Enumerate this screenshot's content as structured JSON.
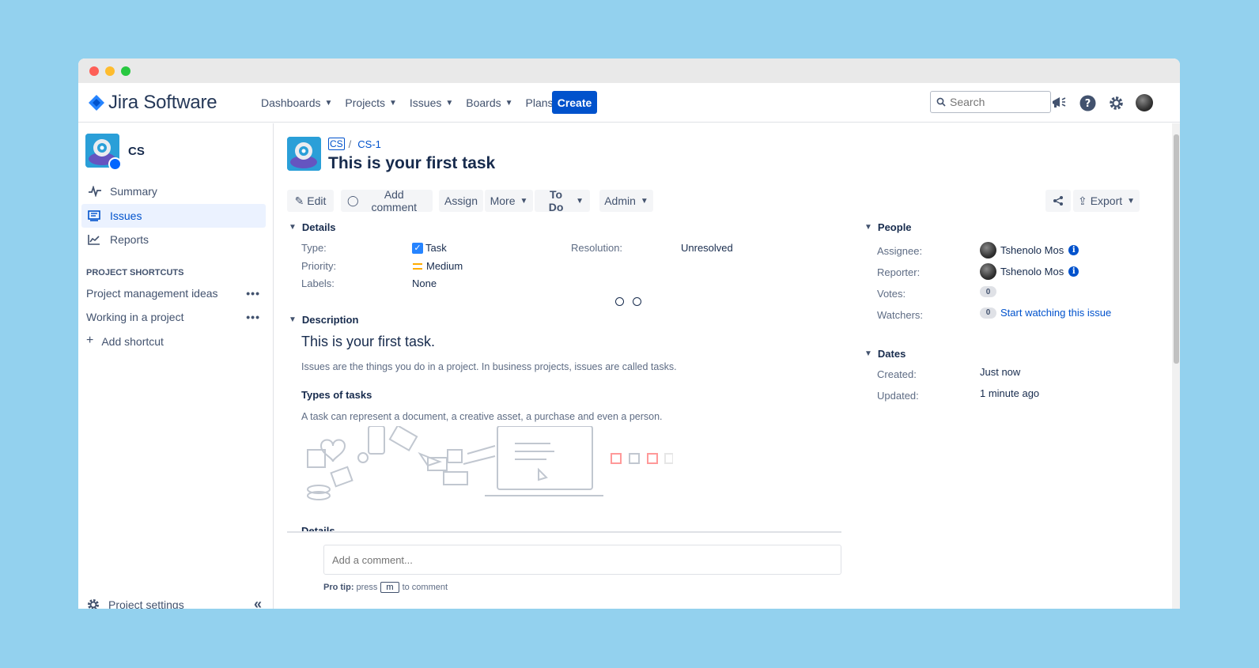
{
  "app": {
    "name": "Jira Software"
  },
  "nav": {
    "items": [
      "Dashboards",
      "Projects",
      "Issues",
      "Boards",
      "Plans"
    ],
    "create_label": "Create",
    "search_placeholder": "Search"
  },
  "sidebar": {
    "project_name": "CS",
    "items": [
      {
        "label": "Summary",
        "icon": "pulse-icon"
      },
      {
        "label": "Issues",
        "icon": "issues-icon",
        "active": true
      },
      {
        "label": "Reports",
        "icon": "chart-icon"
      }
    ],
    "shortcuts_heading": "PROJECT SHORTCUTS",
    "shortcuts": [
      "Project management ideas",
      "Working in a project"
    ],
    "add_shortcut": "Add shortcut",
    "settings": "Project settings"
  },
  "issue": {
    "project_key": "CS",
    "key": "CS-1",
    "title": "This is your first task",
    "buttons": {
      "edit": "Edit",
      "add_comment": "Add comment",
      "assign": "Assign",
      "more": "More",
      "status": "To Do",
      "admin": "Admin",
      "export": "Export"
    },
    "details": {
      "heading": "Details",
      "type_label": "Type:",
      "type_value": "Task",
      "priority_label": "Priority:",
      "priority_value": "Medium",
      "labels_label": "Labels:",
      "labels_value": "None",
      "resolution_label": "Resolution:",
      "resolution_value": "Unresolved"
    },
    "description": {
      "heading": "Description",
      "title": "This is your first task.",
      "text1": "Issues are the things you do in a project. In business projects, issues are called tasks.",
      "subheading": "Types of tasks",
      "text2": "A task can represent a document, a creative asset, a purchase and even a person.",
      "cut_heading": "Details"
    },
    "comment": {
      "placeholder": "Add a comment...",
      "protip_bold": "Pro tip:",
      "protip_pre": "press",
      "protip_key": "m",
      "protip_post": "to comment"
    },
    "people": {
      "heading": "People",
      "assignee_label": "Assignee:",
      "assignee": "Tshenolo Mos",
      "reporter_label": "Reporter:",
      "reporter": "Tshenolo Mos",
      "votes_label": "Votes:",
      "votes": "0",
      "watchers_label": "Watchers:",
      "watchers": "0",
      "watch_link": "Start watching this issue"
    },
    "dates": {
      "heading": "Dates",
      "created_label": "Created:",
      "created": "Just now",
      "updated_label": "Updated:",
      "updated": "1 minute ago"
    }
  },
  "colors": {
    "brand": "#0052cc",
    "background": "#93d1ee"
  }
}
